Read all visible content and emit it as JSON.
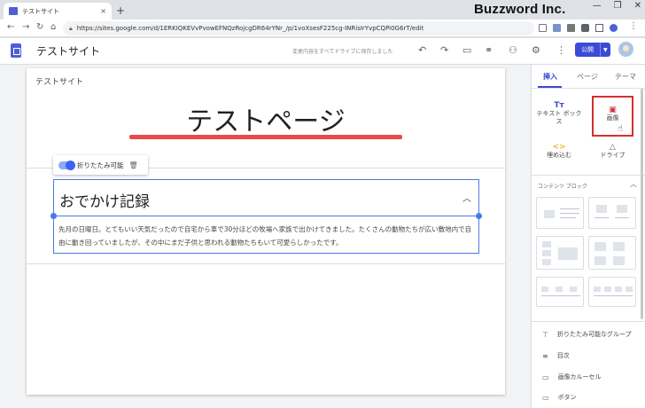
{
  "browser": {
    "tab_title": "テストサイト",
    "tab_close": "×",
    "new_tab": "+",
    "url": "https://sites.google.com/d/1ERKIQKEVvPvowEFNQzRojcgDR64rYNr_/p/1voXsesF225cg-INRisIrYvpCQPi0G6rT/edit",
    "window_controls": [
      "—",
      "❐",
      "✕"
    ]
  },
  "watermark": "Buzzword Inc.",
  "header": {
    "site_title": "テストサイト",
    "save_status": "変更内容をすべてドライブに保存しました",
    "publish_label": "公開"
  },
  "page": {
    "site_name": "テストサイト",
    "heading": "テストページ",
    "toggle_label": "折りたたみ可能",
    "collapsible": {
      "title": "おでかけ記録",
      "body": "先月の日曜日。とてもいい天気だったので自宅から車で30分ほどの牧場へ家族で出かけてきました。たくさんの動物たちが広い敷地内で自由に動き回っていましたが、その中にまだ子供と思われる動物たちもいて可愛らしかったです。",
      "expanded": true
    }
  },
  "panel": {
    "tabs": [
      "挿入",
      "ページ",
      "テーマ"
    ],
    "active_tab": "挿入",
    "insert_items": [
      {
        "icon": "Tт",
        "label": "テキスト ボックス"
      },
      {
        "icon": "▣",
        "label": "画像"
      },
      {
        "icon": "<>",
        "label": "埋め込む"
      },
      {
        "icon": "△",
        "label": "ドライブ"
      }
    ],
    "content_blocks_label": "コンテンツ ブロック",
    "list_items": [
      {
        "icon": "⊤",
        "label": "折りたたみ可能なグループ"
      },
      {
        "icon": "≡",
        "label": "目次"
      },
      {
        "icon": "▭",
        "label": "画像カルーセル"
      },
      {
        "icon": "▭",
        "label": "ボタン"
      }
    ]
  },
  "colors": {
    "accent": "#3c4bd6",
    "highlight_box": "#d62f2f",
    "heading_underline": "#e94b4b",
    "selection": "#4b79e8"
  }
}
